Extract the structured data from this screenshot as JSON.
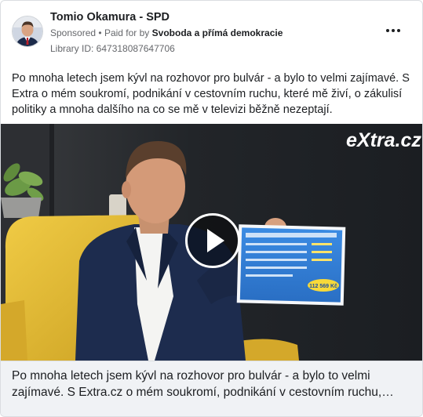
{
  "post": {
    "page_name": "Tomio Okamura - SPD",
    "sponsored_label": "Sponsored",
    "separator": "•",
    "paid_for_prefix": "Paid for by",
    "payer": "Svoboda a přímá demokracie",
    "library_id": "Library ID: 647318087647706",
    "text": "Po mnoha letech jsem kývl na rozhovor pro bulvár - a bylo to velmi zajímavé. S Extra o mém soukromí, podnikání v cestovním ruchu, které mě živí, o zákulisí politiky a mnoha dalšího na co se mě v televizi běžně nezeptají.",
    "more_icon": "more-horizontal-icon"
  },
  "video": {
    "watermark": "eXtra.cz",
    "play_icon": "play-icon",
    "sign_amount": "112 569 Kč",
    "colors": {
      "chair": "#e9c237",
      "background": "#22252a",
      "suit": "#1d2c4e",
      "paper": "#2f7fd8"
    }
  },
  "caption": {
    "line1": "Po mnoha letech jsem kývl na rozhovor pro bulvár - a bylo to velmi",
    "line2": "zajímavé. S Extra.cz o mém soukromí, podnikání v cestovním ruchu,…"
  }
}
